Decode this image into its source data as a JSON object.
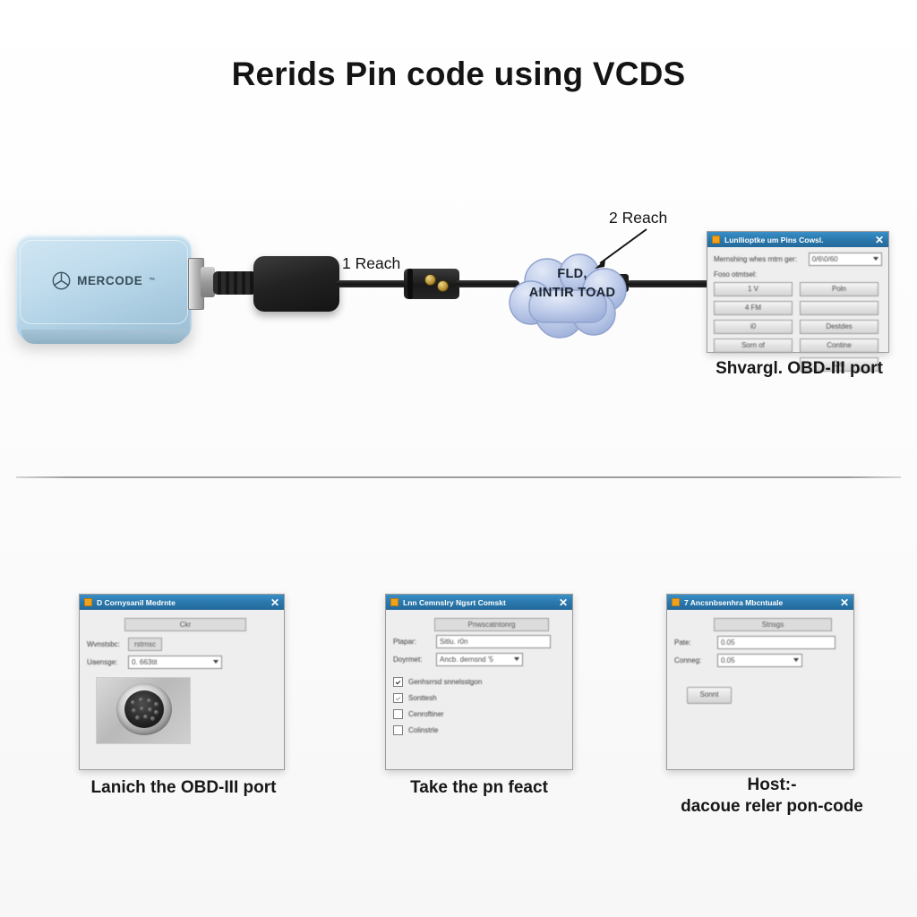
{
  "page": {
    "title": "Rerids Pin code using VCDS"
  },
  "scene": {
    "device": {
      "brand": "MERCODE",
      "trademark": "™",
      "logo_icon": "mercedes-star-icon",
      "body_color": "#bfdced"
    },
    "callouts": [
      {
        "id": "callout-1",
        "text": "1  Reach"
      },
      {
        "id": "callout-2",
        "text": "2  Reach"
      }
    ],
    "cloud": {
      "line1": "FLD,",
      "line2": "AINTIR TOAD",
      "fill": "#b6c6e6"
    }
  },
  "top_dialog": {
    "title": "Lunllioptke um Pins Cowsl.",
    "close_label": "✕",
    "rows": [
      {
        "label": "Mernshing whes rntrn ger:",
        "value": "0/6\\0/60"
      }
    ],
    "sub_label": "Foso otmtsel:",
    "left_buttons": [
      "1 V",
      "4 FM",
      "i0",
      "Sorn of"
    ],
    "right_buttons": [
      "Poln",
      "",
      "Destdes",
      "Contine",
      "Dat"
    ],
    "caption": "Shvargl. OBD-III port"
  },
  "bottom_panels": [
    {
      "id": "win-left",
      "title": "D Cornysanil Medrnte",
      "close_label": "✕",
      "top_button": "Ckr",
      "fields": [
        {
          "label": "Wvnstsbc:",
          "type": "greybox",
          "value": "rstrnsc"
        },
        {
          "label": "Uaensge:",
          "type": "combo",
          "value": "0. 663tit"
        }
      ],
      "photo_icon": "obd-port-photo",
      "caption": "Lanich the  OBD-III port"
    },
    {
      "id": "win-mid",
      "title": "Lnn Cemnslry Ngsrt Comskt",
      "close_label": "✕",
      "top_button": "Pnwscatntonrg",
      "fields": [
        {
          "label": "Ptapar:",
          "type": "textbox",
          "value": "Sitlu. r0n"
        },
        {
          "label": "Doyrmet:",
          "type": "combo",
          "value": "Ancb. dernsnd '5"
        }
      ],
      "checkboxes": [
        {
          "label": "Genhsrrsd snnelsstgon",
          "state": "on"
        },
        {
          "label": "Sonttesh",
          "state": "half"
        },
        {
          "label": "Cenroftiner",
          "state": "off"
        },
        {
          "label": "Colinstrle",
          "state": "off"
        }
      ],
      "caption": "Take the pn feact"
    },
    {
      "id": "win-right",
      "title": "7 Ancsnbsenhra Mbcntuale",
      "close_label": "✕",
      "top_button": "Stnsgs",
      "fields": [
        {
          "label": "Pate:",
          "type": "textbox",
          "value": "0.05"
        },
        {
          "label": "Conneg:",
          "type": "combo",
          "value": "0.05"
        }
      ],
      "action_button": "Sonnt",
      "caption_line1": "Host:-",
      "caption_line2": "dacoue reler pon-code"
    }
  ],
  "colors": {
    "title_bar": "#2a79ae",
    "device_blue": "#bfdced",
    "cloud_blue": "#b6c6e6",
    "divider": "#8d8d8d"
  }
}
